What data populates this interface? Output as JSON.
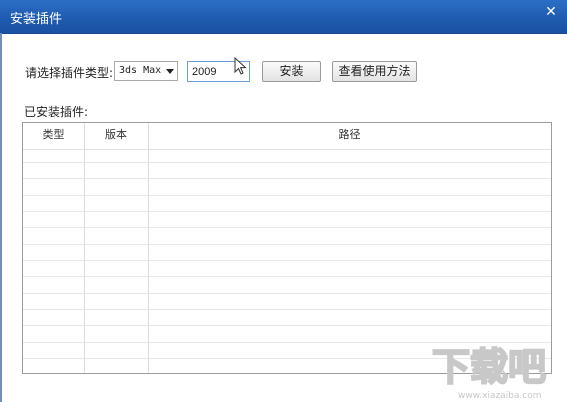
{
  "window": {
    "title": "安装插件",
    "close_glyph": "✕"
  },
  "form": {
    "plugin_type_label": "请选择插件类型:",
    "plugin_type_value": "3ds Max",
    "version_value": "2009",
    "install_button": "安装",
    "help_button": "查看使用方法"
  },
  "installed": {
    "label": "已安装插件:",
    "columns": [
      "类型",
      "版本",
      "路径"
    ],
    "rows": []
  },
  "watermark": {
    "text": "下载吧",
    "url": "www.xiazaiba.com"
  }
}
